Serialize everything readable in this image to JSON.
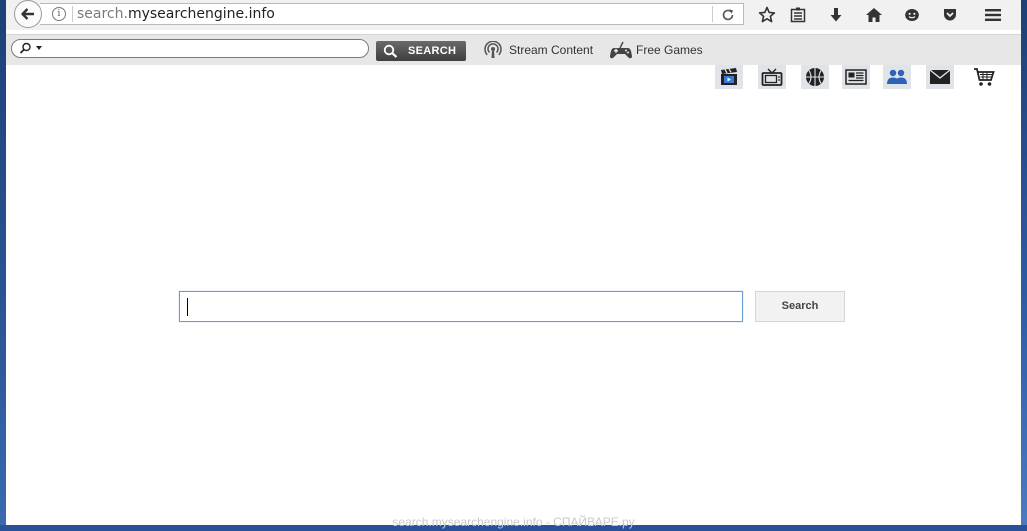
{
  "browser": {
    "url_prefix": "search.",
    "url_domain": "mysearchengine.info",
    "toolbar_icons": [
      "bookmark-star-icon",
      "reading-list-icon",
      "download-icon",
      "home-icon",
      "smiley-icon",
      "pocket-icon",
      "menu-icon"
    ]
  },
  "search_toolbar": {
    "search_button_label": "SEARCH",
    "links": [
      {
        "label": "Stream Content",
        "icon": "stream-icon"
      },
      {
        "label": "Free Games",
        "icon": "gamepad-icon"
      }
    ]
  },
  "page_icons": [
    "video-icon",
    "tv-icon",
    "basketball-icon",
    "news-icon",
    "people-icon",
    "mail-icon",
    "cart-icon"
  ],
  "main": {
    "search_value": "",
    "search_button_label": "Search"
  },
  "watermark": "search.mysearchengine.info - СПАЙВАРЕ.ру"
}
